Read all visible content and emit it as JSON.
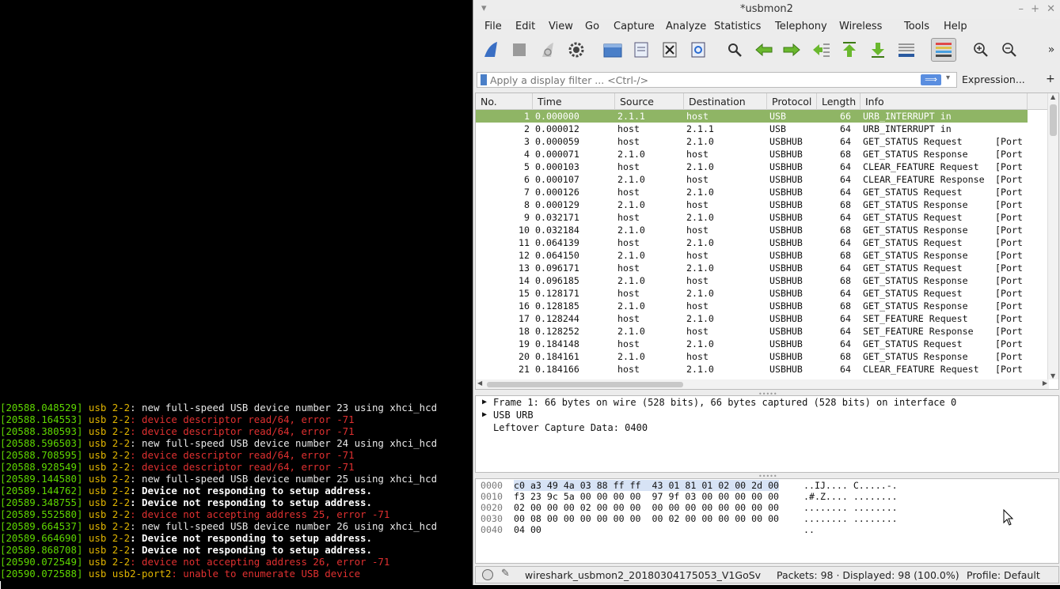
{
  "terminal": {
    "lines": [
      {
        "ts": "[20588.048529]",
        "dev": "usb 2-2",
        "msg": ": new full-speed USB device number 23 using xhci_hcd",
        "style": "normal"
      },
      {
        "ts": "[20588.164553]",
        "dev": "usb 2-2",
        "msg": ": device descriptor read/64, error -71",
        "style": "err"
      },
      {
        "ts": "[20588.380593]",
        "dev": "usb 2-2",
        "msg": ": device descriptor read/64, error -71",
        "style": "err"
      },
      {
        "ts": "[20588.596503]",
        "dev": "usb 2-2",
        "msg": ": new full-speed USB device number 24 using xhci_hcd",
        "style": "normal"
      },
      {
        "ts": "[20588.708595]",
        "dev": "usb 2-2",
        "msg": ": device descriptor read/64, error -71",
        "style": "err"
      },
      {
        "ts": "[20588.928549]",
        "dev": "usb 2-2",
        "msg": ": device descriptor read/64, error -71",
        "style": "err"
      },
      {
        "ts": "[20589.144580]",
        "dev": "usb 2-2",
        "msg": ": new full-speed USB device number 25 using xhci_hcd",
        "style": "normal"
      },
      {
        "ts": "[20589.144762]",
        "dev": "usb 2-2",
        "msg": ": Device not responding to setup address.",
        "style": "bold"
      },
      {
        "ts": "[20589.348755]",
        "dev": "usb 2-2",
        "msg": ": Device not responding to setup address.",
        "style": "bold"
      },
      {
        "ts": "[20589.552580]",
        "dev": "usb 2-2",
        "msg": ": device not accepting address 25, error -71",
        "style": "err"
      },
      {
        "ts": "[20589.664537]",
        "dev": "usb 2-2",
        "msg": ": new full-speed USB device number 26 using xhci_hcd",
        "style": "normal"
      },
      {
        "ts": "[20589.664690]",
        "dev": "usb 2-2",
        "msg": ": Device not responding to setup address.",
        "style": "bold"
      },
      {
        "ts": "[20589.868708]",
        "dev": "usb 2-2",
        "msg": ": Device not responding to setup address.",
        "style": "bold"
      },
      {
        "ts": "[20590.072549]",
        "dev": "usb 2-2",
        "msg": ": device not accepting address 26, error -71",
        "style": "err"
      },
      {
        "ts": "[20590.072588]",
        "dev": "usb usb2-port2",
        "msg": ": unable to enumerate USB device",
        "style": "err"
      }
    ]
  },
  "window": {
    "title": "*usbmon2",
    "menu": [
      "File",
      "Edit",
      "View",
      "Go",
      "Capture",
      "Analyze",
      "Statistics",
      "Telephony",
      "Wireless",
      "Tools",
      "Help"
    ],
    "toolbar_icons": [
      "shark-fin-start-icon",
      "stop-icon",
      "restart-icon",
      "options-gear-icon",
      "open-folder-icon",
      "save-file-icon",
      "close-file-icon",
      "reload-icon",
      "find-icon",
      "go-back-icon",
      "go-forward-icon",
      "go-to-packet-icon",
      "first-packet-icon",
      "last-packet-icon",
      "autoscroll-icon",
      "colorize-icon",
      "zoom-in-icon",
      "zoom-out-icon"
    ],
    "filter": {
      "placeholder": "Apply a display filter ... <Ctrl-/>",
      "expression_label": "Expression...",
      "add_label": "+"
    },
    "columns": [
      "No.",
      "Time",
      "Source",
      "Destination",
      "Protocol",
      "Length",
      "Info"
    ],
    "packets": [
      {
        "no": "1",
        "time": "0.000000",
        "src": "2.1.1",
        "dst": "host",
        "proto": "USB",
        "len": "66",
        "info": "URB_INTERRUPT in",
        "extra": ""
      },
      {
        "no": "2",
        "time": "0.000012",
        "src": "host",
        "dst": "2.1.1",
        "proto": "USB",
        "len": "64",
        "info": "URB_INTERRUPT in",
        "extra": ""
      },
      {
        "no": "3",
        "time": "0.000059",
        "src": "host",
        "dst": "2.1.0",
        "proto": "USBHUB",
        "len": "64",
        "info": "GET_STATUS Request",
        "extra": "[Port"
      },
      {
        "no": "4",
        "time": "0.000071",
        "src": "2.1.0",
        "dst": "host",
        "proto": "USBHUB",
        "len": "68",
        "info": "GET_STATUS Response",
        "extra": "[Port"
      },
      {
        "no": "5",
        "time": "0.000103",
        "src": "host",
        "dst": "2.1.0",
        "proto": "USBHUB",
        "len": "64",
        "info": "CLEAR_FEATURE Request",
        "extra": "[Port"
      },
      {
        "no": "6",
        "time": "0.000107",
        "src": "2.1.0",
        "dst": "host",
        "proto": "USBHUB",
        "len": "64",
        "info": "CLEAR_FEATURE Response",
        "extra": "[Port"
      },
      {
        "no": "7",
        "time": "0.000126",
        "src": "host",
        "dst": "2.1.0",
        "proto": "USBHUB",
        "len": "64",
        "info": "GET_STATUS Request",
        "extra": "[Port"
      },
      {
        "no": "8",
        "time": "0.000129",
        "src": "2.1.0",
        "dst": "host",
        "proto": "USBHUB",
        "len": "68",
        "info": "GET_STATUS Response",
        "extra": "[Port"
      },
      {
        "no": "9",
        "time": "0.032171",
        "src": "host",
        "dst": "2.1.0",
        "proto": "USBHUB",
        "len": "64",
        "info": "GET_STATUS Request",
        "extra": "[Port"
      },
      {
        "no": "10",
        "time": "0.032184",
        "src": "2.1.0",
        "dst": "host",
        "proto": "USBHUB",
        "len": "68",
        "info": "GET_STATUS Response",
        "extra": "[Port"
      },
      {
        "no": "11",
        "time": "0.064139",
        "src": "host",
        "dst": "2.1.0",
        "proto": "USBHUB",
        "len": "64",
        "info": "GET_STATUS Request",
        "extra": "[Port"
      },
      {
        "no": "12",
        "time": "0.064150",
        "src": "2.1.0",
        "dst": "host",
        "proto": "USBHUB",
        "len": "68",
        "info": "GET_STATUS Response",
        "extra": "[Port"
      },
      {
        "no": "13",
        "time": "0.096171",
        "src": "host",
        "dst": "2.1.0",
        "proto": "USBHUB",
        "len": "64",
        "info": "GET_STATUS Request",
        "extra": "[Port"
      },
      {
        "no": "14",
        "time": "0.096185",
        "src": "2.1.0",
        "dst": "host",
        "proto": "USBHUB",
        "len": "68",
        "info": "GET_STATUS Response",
        "extra": "[Port"
      },
      {
        "no": "15",
        "time": "0.128171",
        "src": "host",
        "dst": "2.1.0",
        "proto": "USBHUB",
        "len": "64",
        "info": "GET_STATUS Request",
        "extra": "[Port"
      },
      {
        "no": "16",
        "time": "0.128185",
        "src": "2.1.0",
        "dst": "host",
        "proto": "USBHUB",
        "len": "68",
        "info": "GET_STATUS Response",
        "extra": "[Port"
      },
      {
        "no": "17",
        "time": "0.128244",
        "src": "host",
        "dst": "2.1.0",
        "proto": "USBHUB",
        "len": "64",
        "info": "SET_FEATURE Request",
        "extra": "[Port"
      },
      {
        "no": "18",
        "time": "0.128252",
        "src": "2.1.0",
        "dst": "host",
        "proto": "USBHUB",
        "len": "64",
        "info": "SET_FEATURE Response",
        "extra": "[Port"
      },
      {
        "no": "19",
        "time": "0.184148",
        "src": "host",
        "dst": "2.1.0",
        "proto": "USBHUB",
        "len": "64",
        "info": "GET_STATUS Request",
        "extra": "[Port"
      },
      {
        "no": "20",
        "time": "0.184161",
        "src": "2.1.0",
        "dst": "host",
        "proto": "USBHUB",
        "len": "68",
        "info": "GET_STATUS Response",
        "extra": "[Port"
      },
      {
        "no": "21",
        "time": "0.184166",
        "src": "host",
        "dst": "2.1.0",
        "proto": "USBHUB",
        "len": "64",
        "info": "CLEAR_FEATURE Request",
        "extra": "[Port"
      }
    ],
    "details": [
      {
        "text": "Frame 1: 66 bytes on wire (528 bits), 66 bytes captured (528 bits) on interface 0",
        "expandable": true
      },
      {
        "text": "USB URB",
        "expandable": true
      },
      {
        "text": "Leftover Capture Data: 0400",
        "expandable": false
      }
    ],
    "hex": [
      {
        "off": "0000",
        "bytes": "c0 a3 49 4a 03 88 ff ff  43 01 81 01 02 00 2d 00",
        "ascii": "..IJ.... C.....-."
      },
      {
        "off": "0010",
        "bytes": "f3 23 9c 5a 00 00 00 00  97 9f 03 00 00 00 00 00",
        "ascii": ".#.Z.... ........"
      },
      {
        "off": "0020",
        "bytes": "02 00 00 00 02 00 00 00  00 00 00 00 00 00 00 00",
        "ascii": "........ ........"
      },
      {
        "off": "0030",
        "bytes": "00 08 00 00 00 00 00 00  00 02 00 00 00 00 00 00",
        "ascii": "........ ........"
      },
      {
        "off": "0040",
        "bytes": "04 00",
        "ascii": ".."
      }
    ],
    "status": {
      "file": "wireshark_usbmon2_20180304175053_V1GoSv",
      "packets": "Packets: 98 · Displayed: 98 (100.0%)",
      "profile": "Profile: Default"
    }
  }
}
